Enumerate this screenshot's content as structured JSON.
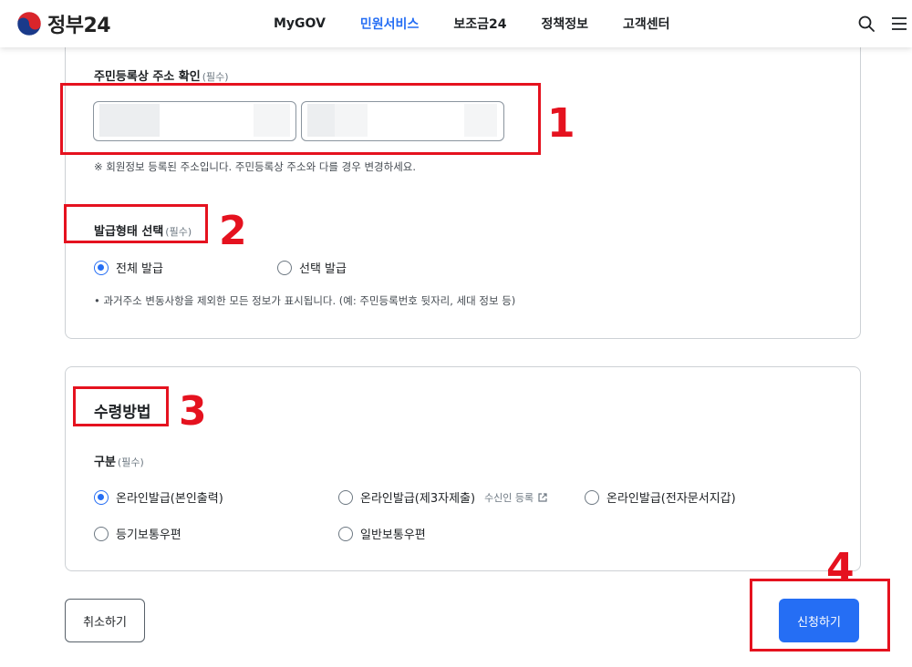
{
  "header": {
    "logo_text": "정부24",
    "nav": [
      "MyGOV",
      "민원서비스",
      "보조금24",
      "정책정보",
      "고객센터"
    ],
    "active_nav": "민원서비스"
  },
  "address": {
    "label": "주민등록상 주소 확인",
    "required": "(필수)",
    "note": "※ 회원정보 등록된 주소입니다. 주민등록상 주소와 다를 경우 변경하세요."
  },
  "issue_type": {
    "label": "발급형태 선택",
    "required": "(필수)",
    "options": [
      "전체 발급",
      "선택 발급"
    ],
    "selected": "전체 발급",
    "note": "• 과거주소 변동사항을 제외한 모든 정보가 표시됩니다. (예: 주민등록번호 뒷자리, 세대 정보 등)"
  },
  "receive": {
    "title": "수령방법",
    "label": "구분",
    "required": "(필수)",
    "options": [
      "온라인발급(본인출력)",
      "온라인발급(제3자제출)",
      "온라인발급(전자문서지갑)",
      "등기보통우편",
      "일반보통우편"
    ],
    "selected": "온라인발급(본인출력)",
    "recipient_link": "수신인 등록"
  },
  "buttons": {
    "cancel": "취소하기",
    "apply": "신청하기"
  },
  "annotations": [
    "1",
    "2",
    "3",
    "4"
  ],
  "colors": {
    "accent": "#256ef4",
    "annotation": "#e5121f"
  }
}
